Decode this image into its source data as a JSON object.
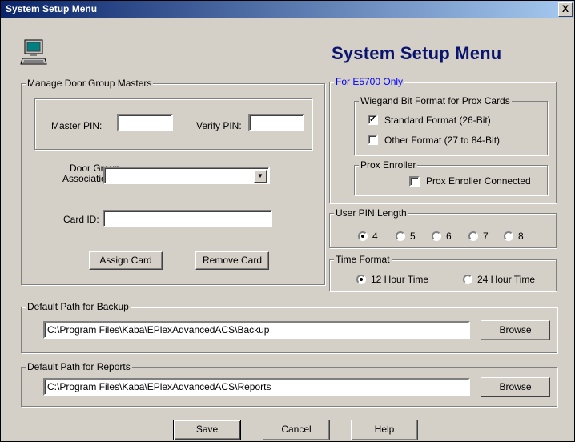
{
  "window": {
    "title": "System Setup Menu",
    "close_glyph": "X"
  },
  "header": {
    "title": "System Setup Menu",
    "icon": "computer-icon"
  },
  "door_group": {
    "legend": "Manage Door Group Masters",
    "master_pin_label": "Master PIN:",
    "master_pin_value": "",
    "verify_pin_label": "Verify PIN:",
    "verify_pin_value": "",
    "association_label_1": "Door Group",
    "association_label_2": "Association:",
    "association_value": "",
    "card_id_label": "Card ID:",
    "card_id_value": "",
    "assign_button": "Assign Card",
    "remove_button": "Remove Card"
  },
  "e5700": {
    "legend": "For E5700 Only",
    "legend_color": "#0000ff",
    "wiegand_legend": "Wiegand Bit Format for Prox Cards",
    "standard_label": "Standard Format (26-Bit)",
    "standard_checked": true,
    "other_label": "Other Format (27 to 84-Bit)",
    "other_checked": false,
    "enroller_legend": "Prox Enroller",
    "enroller_label": "Prox Enroller Connected",
    "enroller_checked": false,
    "check_glyph": "✓"
  },
  "pin_length": {
    "legend": "User PIN Length",
    "options": [
      "4",
      "5",
      "6",
      "7",
      "8"
    ],
    "selected": "4"
  },
  "time_format": {
    "legend": "Time Format",
    "option_12": "12 Hour Time",
    "option_24": "24 Hour Time",
    "selected": "12 Hour Time"
  },
  "backup": {
    "legend": "Default Path for Backup",
    "path": "C:\\Program Files\\Kaba\\EPlexAdvancedACS\\Backup",
    "browse_button": "Browse"
  },
  "reports": {
    "legend": "Default Path for Reports",
    "path": "C:\\Program Files\\Kaba\\EPlexAdvancedACS\\Reports",
    "browse_button": "Browse"
  },
  "footer": {
    "save_button": "Save",
    "cancel_button": "Cancel",
    "help_button": "Help"
  }
}
